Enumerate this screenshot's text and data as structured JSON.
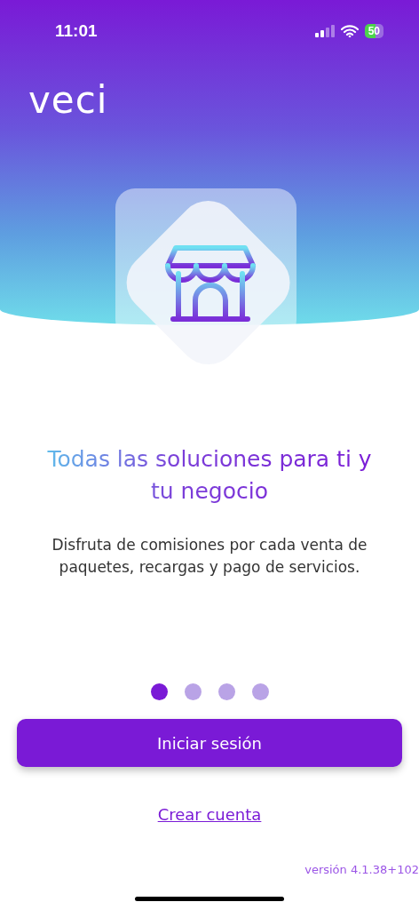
{
  "status_bar": {
    "time": "11:01",
    "battery": "50"
  },
  "logo": "veci",
  "title": "Todas las soluciones para ti y tu negocio",
  "description": "Disfruta de comisiones por cada venta de paquetes, recargas y pago de servicios.",
  "pager": [
    {
      "selected": true
    },
    {
      "selected": false
    },
    {
      "selected": false
    },
    {
      "selected": false
    }
  ],
  "primary_button": "Iniciar sesión",
  "secondary_link": "Crear cuenta",
  "version": "versión 4.1.38+102"
}
